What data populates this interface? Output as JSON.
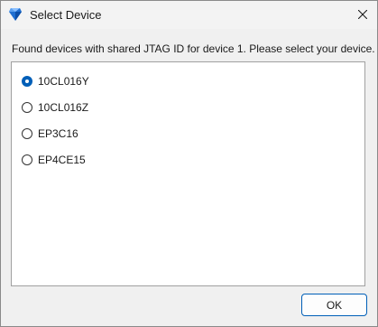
{
  "window": {
    "title": "Select Device",
    "close_icon": "close-icon",
    "app_icon": "quartus-app-icon"
  },
  "prompt": "Found devices with shared JTAG ID for device 1. Please select your device.",
  "devices": [
    {
      "label": "10CL016Y",
      "selected": true
    },
    {
      "label": "10CL016Z",
      "selected": false
    },
    {
      "label": "EP3C16",
      "selected": false
    },
    {
      "label": "EP4CE15",
      "selected": false
    }
  ],
  "buttons": {
    "ok_label": "OK"
  },
  "colors": {
    "accent": "#005fb8",
    "dialog_bg": "#f0f0f0",
    "list_bg": "#ffffff"
  }
}
